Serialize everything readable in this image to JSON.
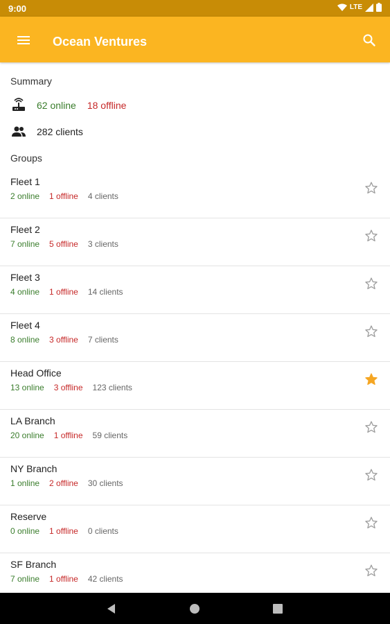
{
  "status_bar": {
    "time": "9:00",
    "network": "LTE"
  },
  "app_bar": {
    "title": "Ocean Ventures"
  },
  "summary": {
    "title": "Summary",
    "online": "62 online",
    "offline": "18 offline",
    "clients": "282 clients"
  },
  "groups_title": "Groups",
  "groups": [
    {
      "name": "Fleet 1",
      "online": "2 online",
      "offline": "1 offline",
      "clients": "4 clients",
      "favorite": false
    },
    {
      "name": "Fleet 2",
      "online": "7 online",
      "offline": "5 offline",
      "clients": "3 clients",
      "favorite": false
    },
    {
      "name": "Fleet 3",
      "online": "4 online",
      "offline": "1 offline",
      "clients": "14 clients",
      "favorite": false
    },
    {
      "name": "Fleet 4",
      "online": "8 online",
      "offline": "3 offline",
      "clients": "7 clients",
      "favorite": false
    },
    {
      "name": "Head Office",
      "online": "13 online",
      "offline": "3 offline",
      "clients": "123 clients",
      "favorite": true
    },
    {
      "name": "LA Branch",
      "online": "20 online",
      "offline": "1 offline",
      "clients": "59 clients",
      "favorite": false
    },
    {
      "name": "NY Branch",
      "online": "1 online",
      "offline": "2 offline",
      "clients": "30 clients",
      "favorite": false
    },
    {
      "name": "Reserve",
      "online": "0 online",
      "offline": "1 offline",
      "clients": "0 clients",
      "favorite": false
    },
    {
      "name": "SF Branch",
      "online": "7 online",
      "offline": "1 offline",
      "clients": "42 clients",
      "favorite": false
    }
  ],
  "colors": {
    "app_bar": "#fbb521",
    "status_bar": "#c88c06",
    "online": "#3a7d2c",
    "offline": "#c62828",
    "favorite_star": "#f5a623"
  },
  "icons": {
    "menu": "menu-icon",
    "search": "search-icon",
    "device": "router-icon",
    "clients": "people-icon",
    "star": "star-icon",
    "back": "back-icon",
    "home": "home-icon",
    "recents": "recents-icon"
  }
}
